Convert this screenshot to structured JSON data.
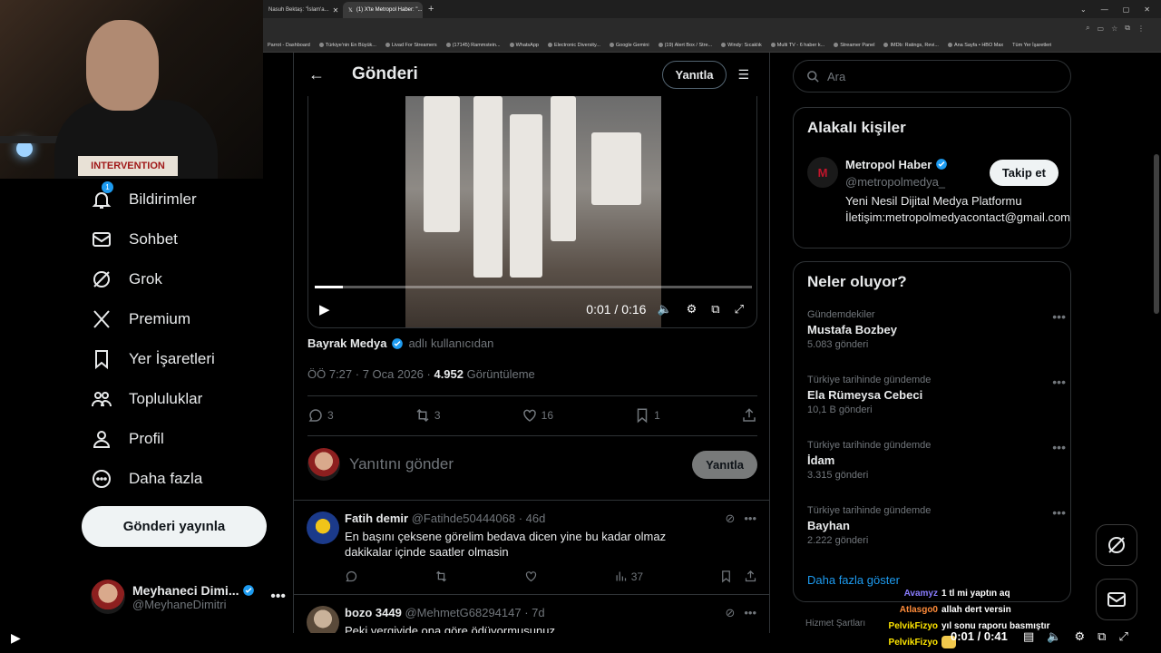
{
  "browser": {
    "tabs": [
      {
        "title": "Nasuh Bektaş: \"İslam'a..."
      },
      {
        "title": "(1) X'te Metropol Haber: \"..."
      }
    ],
    "bookmarks": [
      "Parrot - Dashboard",
      "Türkiye'nin En Büyük...",
      "Livad For Streamers",
      "(17145) Rammstein...",
      "WhatsApp",
      "Electronic Diversity...",
      "Google Gemini",
      "(19) Alert Box / Stre...",
      "Windy: Sıcaklık",
      "Multi TV - 6 haber k...",
      "Streamer Panel",
      "IMDb: Ratings, Revi...",
      "Ana Sayfa • HBO Max",
      "Tüm Yer İşaretleri"
    ]
  },
  "webcam": {
    "shirt_text": "INTERVENTION"
  },
  "nav": {
    "notifications": {
      "label": "Bildirimler",
      "badge": "1"
    },
    "messages": "Sohbet",
    "grok": "Grok",
    "premium": "Premium",
    "bookmarks": "Yer İşaretleri",
    "communities": "Topluluklar",
    "profile": "Profil",
    "more": "Daha fazla",
    "post_button": "Gönderi yayınla"
  },
  "account": {
    "name": "Meyhaneci Dimi...",
    "handle": "@MeyhaneDimitri"
  },
  "main": {
    "title": "Gönderi",
    "reply_button": "Yanıtla",
    "video": {
      "time": "0:01 / 0:16",
      "progress": 0.065
    },
    "source": {
      "author": "Bayrak Medya",
      "suffix": "adlı kullanıcıdan"
    },
    "meta": {
      "time": "ÖÖ 7:27 · 7 Oca 2026 · ",
      "views": "4.952",
      "views_label": " Görüntüleme"
    },
    "stats": {
      "replies": "3",
      "reposts": "3",
      "likes": "16",
      "bookmarks": "1"
    },
    "compose": {
      "placeholder": "Yanıtını gönder",
      "button": "Yanıtla"
    },
    "replies": [
      {
        "name": "Fatih demir",
        "handle": "@Fatihde50444068",
        "time": "· 46d",
        "text": "En başını çeksene görelim bedava dicen yine bu kadar olmaz dakikalar içinde saatler olmasin",
        "views": "37"
      },
      {
        "name": "bozo 3449",
        "handle": "@MehmetG68294147",
        "time": "· 7d",
        "text": "Peki vergiyide ona göre ödüyormusunuz"
      }
    ]
  },
  "right": {
    "search_placeholder": "Ara",
    "related_title": "Alakalı kişiler",
    "person": {
      "name": "Metropol Haber",
      "handle": "@metropolmedya_",
      "bio": "Yeni Nesil Dijital Medya Platformu İletişim:metropolmedyacontact@gmail.com",
      "follow": "Takip et",
      "logo": "M"
    },
    "trends_title": "Neler oluyor?",
    "trends": [
      {
        "context": "Gündemdekiler",
        "name": "Mustafa Bozbey",
        "count": "5.083 gönderi"
      },
      {
        "context": "Türkiye tarihinde gündemde",
        "name": "Ela Rümeysa Cebeci",
        "count": "10,1 B gönderi"
      },
      {
        "context": "Türkiye tarihinde gündemde",
        "name": "İdam",
        "count": "3.315 gönderi"
      },
      {
        "context": "Türkiye tarihinde gündemde",
        "name": "Bayhan",
        "count": "2.222 gönderi"
      }
    ],
    "show_more": "Daha fazla göster",
    "footer": "Hizmet Şartları"
  },
  "chat": [
    {
      "user": "Avamyz",
      "color": "#8a7dff",
      "message": "1 tl mi yaptın aq"
    },
    {
      "user": "Atlasgo0",
      "color": "#ff8c3a",
      "message": "allah dert versin"
    },
    {
      "user": "PelvikFizyo",
      "color": "#ffe600",
      "message": "yıl sonu raporu basmıştır"
    },
    {
      "user": "PelvikFizyo",
      "color": "#ffe600",
      "message": ""
    }
  ],
  "stream_player": {
    "time": "0:01 / 0:41"
  },
  "colors": {
    "accent": "#1d9bf0",
    "background": "#000000",
    "border": "#2f3336",
    "muted": "#71767b"
  }
}
